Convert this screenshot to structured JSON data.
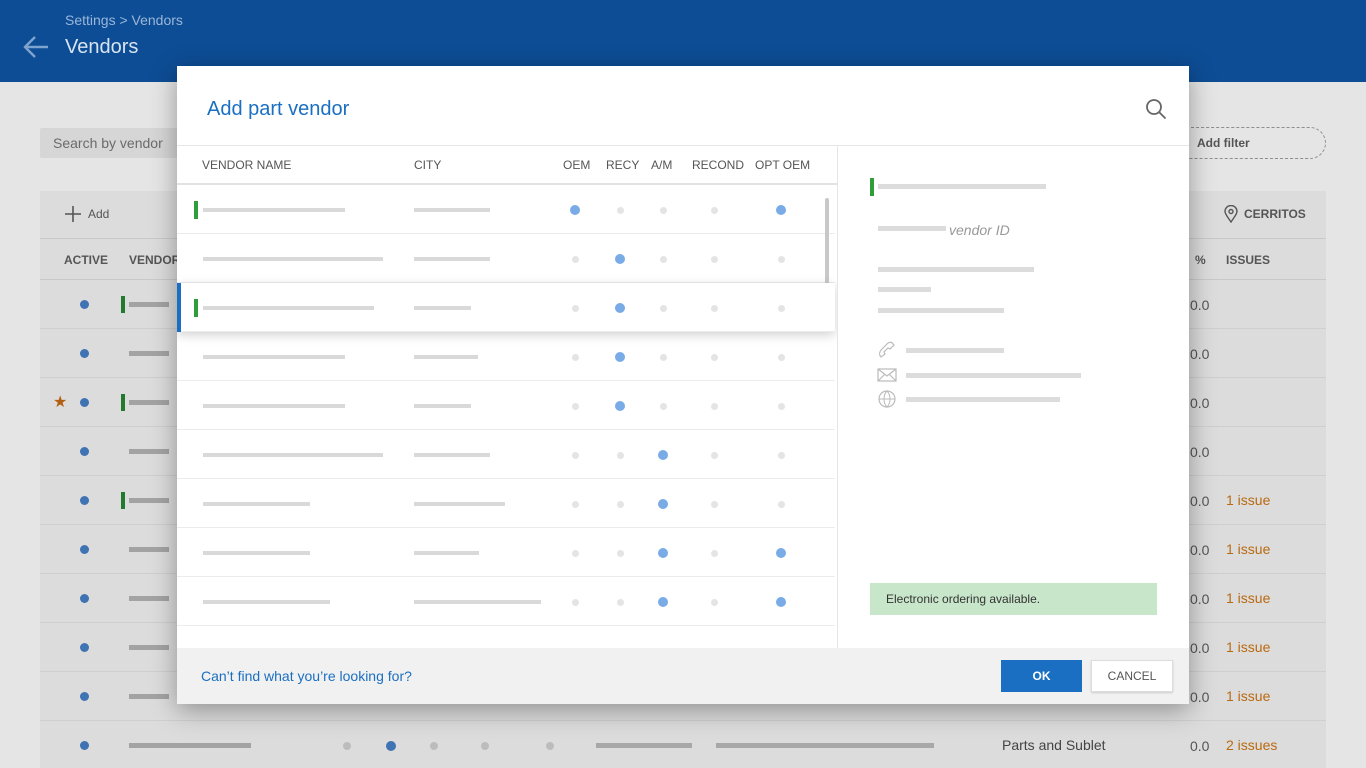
{
  "header": {
    "breadcrumb": "Settings > Vendors",
    "title": "Vendors"
  },
  "background": {
    "search_placeholder": "Search by vendor",
    "add_filter_label": "Add filter",
    "add_label": "Add",
    "location_label": "CERRITOS",
    "columns": {
      "active": "ACTIVE",
      "vendor": "VENDOR",
      "pct": "%",
      "issues": "ISSUES"
    },
    "rows": [
      {
        "star": false,
        "green": true,
        "pct": "0.0",
        "issues": ""
      },
      {
        "star": false,
        "green": false,
        "pct": "0.0",
        "issues": ""
      },
      {
        "star": true,
        "green": true,
        "pct": "0.0",
        "issues": ""
      },
      {
        "star": false,
        "green": false,
        "pct": "0.0",
        "issues": ""
      },
      {
        "star": false,
        "green": true,
        "pct": "0.0",
        "issues": "1 issue"
      },
      {
        "star": false,
        "green": false,
        "pct": "0.0",
        "issues": "1 issue"
      },
      {
        "star": false,
        "green": false,
        "pct": "0.0",
        "issues": "1 issue"
      },
      {
        "star": false,
        "green": false,
        "pct": "0.0",
        "issues": "1 issue"
      },
      {
        "star": false,
        "green": false,
        "pct": "0.0",
        "issues": "1 issue"
      },
      {
        "star": false,
        "green": false,
        "pct": "0.0",
        "issues": "2 issues",
        "type": "Parts and Sublet"
      }
    ]
  },
  "modal": {
    "title": "Add part vendor",
    "columns": {
      "vendor_name": "VENDOR NAME",
      "city": "CITY",
      "oem": "OEM",
      "recy": "RECY",
      "am": "A/M",
      "recond": "RECOND",
      "opt_oem": "OPT OEM"
    },
    "rows": [
      {
        "green": true,
        "selected": false,
        "flags": [
          1,
          0,
          0,
          0,
          1
        ]
      },
      {
        "green": false,
        "selected": false,
        "flags": [
          0,
          1,
          0,
          0,
          0
        ]
      },
      {
        "green": true,
        "selected": true,
        "flags": [
          0,
          1,
          0,
          0,
          0
        ]
      },
      {
        "green": false,
        "selected": false,
        "flags": [
          0,
          1,
          0,
          0,
          0
        ]
      },
      {
        "green": false,
        "selected": false,
        "flags": [
          0,
          1,
          0,
          0,
          0
        ]
      },
      {
        "green": false,
        "selected": false,
        "flags": [
          0,
          0,
          1,
          0,
          0
        ]
      },
      {
        "green": false,
        "selected": false,
        "flags": [
          0,
          0,
          1,
          0,
          0
        ]
      },
      {
        "green": false,
        "selected": false,
        "flags": [
          0,
          0,
          1,
          0,
          1
        ]
      },
      {
        "green": false,
        "selected": false,
        "flags": [
          0,
          0,
          1,
          0,
          1
        ]
      }
    ],
    "detail": {
      "vendor_id_label": "vendor ID",
      "contact_icons": [
        "phone-icon",
        "mail-icon",
        "web-icon"
      ],
      "electronic_ordering": "Electronic ordering available."
    },
    "footer": {
      "cant_find": "Can’t find what you’re looking for?",
      "ok_label": "OK",
      "cancel_label": "CANCEL"
    }
  },
  "colors": {
    "header_bg": "#0d4d95",
    "accent": "#1a6fc2",
    "flag_on": "#79abe6",
    "green_marker": "#2f9e3a",
    "issue": "#b96a10"
  }
}
